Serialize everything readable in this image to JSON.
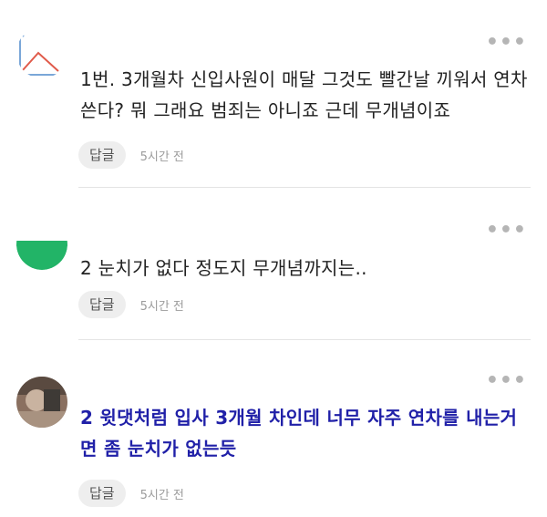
{
  "comments": [
    {
      "number_and_text": "1번. 3개월차 신입사원이 매달 그것도 빨간날 끼워서 연차쓴다? 뭐 그래요 범죄는 아니죠 근데 무개념이죠",
      "reply_label": "답글",
      "time": "5시간 전",
      "avatar_icon": "line-chart-avatar-icon"
    },
    {
      "number_and_text": "2 눈치가 없다 정도지 무개념까지는..",
      "reply_label": "답글",
      "time": "5시간 전",
      "avatar_icon": "green-circle-avatar-icon"
    },
    {
      "number_and_text": "2 윗댓처럼 입사 3개월 차인데 너무 자주 연차를 내는거면 좀 눈치가 없는듯",
      "reply_label": "답글",
      "time": "5시간 전",
      "avatar_icon": "photo-avatar-icon"
    }
  ],
  "more_icon": "more-options-icon",
  "more_glyph": "•••"
}
